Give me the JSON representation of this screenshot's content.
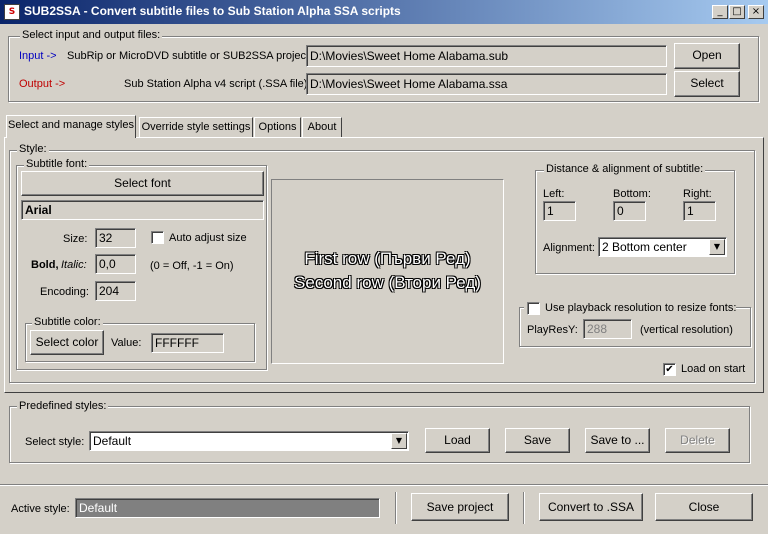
{
  "window": {
    "title": "SUB2SSA - Convert subtitle files to Sub Station Alpha SSA scripts",
    "icon_text": "S"
  },
  "io": {
    "group_label": "Select input and output  files:",
    "input_label": "Input ->",
    "input_desc": "SubRip or MicroDVD subtitle or SUB2SSA project:",
    "input_value": "D:\\Movies\\Sweet Home Alabama.sub",
    "open_label": "Open",
    "output_label": "Output ->",
    "output_desc": "Sub Station Alpha v4 script (.SSA file):",
    "output_value": "D:\\Movies\\Sweet Home Alabama.ssa",
    "select_label": "Select",
    "input_color": "#0000c0",
    "output_color": "#c00000"
  },
  "tabs": [
    {
      "label": "Select and manage styles"
    },
    {
      "label": "Override style settings"
    },
    {
      "label": "Options"
    },
    {
      "label": "About"
    }
  ],
  "style": {
    "group_label": "Style:",
    "font_group_label": "Subtitle font:",
    "select_font_label": "Select font",
    "font_name": "Arial",
    "size_label": "Size:",
    "size_value": "32",
    "auto_adjust_label": "Auto adjust size",
    "bold_label": "Bold,",
    "italic_label": "Italic:",
    "bold_italic_value": "0,0",
    "bold_italic_hint": "(0 = Off, -1 = On)",
    "encoding_label": "Encoding:",
    "encoding_value": "204",
    "color_group_label": "Subtitle color:",
    "select_color_label": "Select color",
    "value_label": "Value:",
    "color_value": "FFFFFF",
    "preview_line1": "First row (Първи Ред)",
    "preview_line2": "Second row (Втори Ред)",
    "distance_group_label": "Distance & alignment of subtitle:",
    "left_label": "Left:",
    "left_value": "1",
    "bottom_label": "Bottom:",
    "bottom_value": "0",
    "right_label": "Right:",
    "right_value": "1",
    "alignment_label": "Alignment:",
    "alignment_value": "2 Bottom center",
    "playback_label": "Use playback resolution to resize fonts:",
    "playresy_label": "PlayResY:",
    "playresy_value": "288",
    "vertical_res_label": "(vertical resolution)",
    "load_on_start_label": "Load on start",
    "load_on_start_checked": "✔"
  },
  "predefined": {
    "group_label": "Predefined styles:",
    "select_style_label": "Select style:",
    "select_style_value": "Default",
    "load_label": "Load",
    "save_label": "Save",
    "save_to_label": "Save to ...",
    "delete_label": "Delete"
  },
  "footer": {
    "active_style_label": "Active style:",
    "active_style_value": "Default",
    "save_project_label": "Save project",
    "convert_label": "Convert to .SSA",
    "close_label": "Close"
  }
}
